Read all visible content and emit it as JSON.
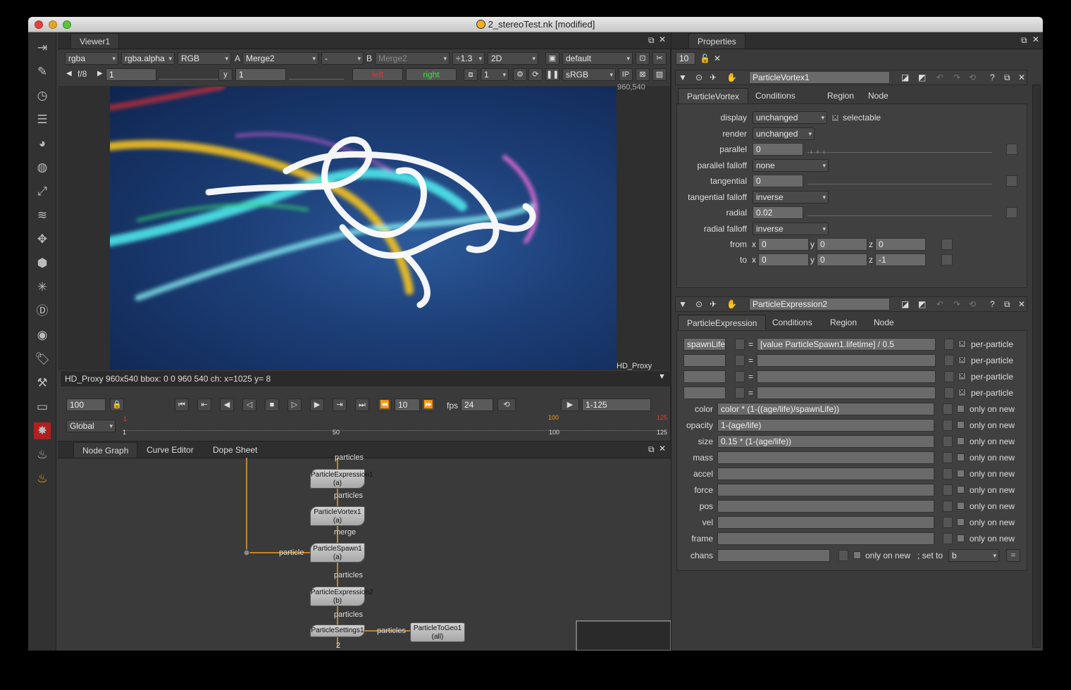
{
  "window": {
    "title": "2_stereoTest.nk [modified]"
  },
  "viewer": {
    "tab": "Viewer1",
    "channels": "rgba",
    "alpha": "rgba.alpha",
    "colorspace": "RGB",
    "a_label": "A",
    "a_input": "Merge2",
    "op": "-",
    "b_label": "B",
    "b_input": "Merge2",
    "zoom": "÷1.3",
    "mode": "2D",
    "lut": "default",
    "fstop": "f/8",
    "gain": "1",
    "gamma_label": "y",
    "gamma": "1",
    "left": "left",
    "right": "right",
    "proxy_num": "1",
    "display": "sRGB",
    "ip": "IP",
    "res_corner": "960,540",
    "format_label": "HD_Proxy",
    "info": "HD_Proxy 960x540 bbox: 0 0 960 540 ch:  x=1025 y=   8",
    "frame": "100",
    "step": "10",
    "fps_label": "fps",
    "fps": "24",
    "range": "1-125",
    "timeline_mode": "Global",
    "ticks": [
      "1",
      "50",
      "100",
      "125"
    ],
    "marks": [
      "1",
      "100",
      "125"
    ]
  },
  "bottom_tabs": [
    "Node Graph",
    "Curve Editor",
    "Dope Sheet"
  ],
  "nodegraph": {
    "nodes": [
      {
        "name": "ParticleExpression1",
        "input": "(a)"
      },
      {
        "name": "ParticleVortex1",
        "input": "(a)"
      },
      {
        "name": "ParticleSpawn1",
        "input": "(a)"
      },
      {
        "name": "ParticleExpression2",
        "input": "(b)"
      },
      {
        "name": "ParticleSettings1",
        "input": ""
      },
      {
        "name": "ParticleToGeo1",
        "input": "(all)"
      }
    ],
    "wires": [
      "particles",
      "particles",
      "merge",
      "particle",
      "particles",
      "particles",
      "particles"
    ],
    "bottom_num": "2"
  },
  "properties": {
    "tab": "Properties",
    "max_panels": "10",
    "vortex": {
      "name": "ParticleVortex1",
      "tabs": [
        "ParticleVortex",
        "Conditions",
        "Region",
        "Node"
      ],
      "display_label": "display",
      "display": "unchanged",
      "selectable": "selectable",
      "render_label": "render",
      "render": "unchanged",
      "parallel_label": "parallel",
      "parallel": "0",
      "parallel_falloff_label": "parallel falloff",
      "parallel_falloff": "none",
      "tangential_label": "tangential",
      "tangential": "0",
      "tangential_falloff_label": "tangential falloff",
      "tangential_falloff": "inverse",
      "radial_label": "radial",
      "radial": "0.02",
      "radial_falloff_label": "radial falloff",
      "radial_falloff": "inverse",
      "from_label": "from",
      "from": {
        "x": "0",
        "y": "0",
        "z": "0"
      },
      "to_label": "to",
      "to": {
        "x": "0",
        "y": "0",
        "z": "-1"
      },
      "axis": [
        "x",
        "y",
        "z"
      ],
      "slider_ticks": [
        "-1",
        "-0.8",
        "-0.6",
        "-0.4",
        "-0.2",
        "0",
        "0.2",
        "0.4",
        "0.6",
        "0.8",
        "1"
      ]
    },
    "expression": {
      "name": "ParticleExpression2",
      "tabs": [
        "ParticleExpression",
        "Conditions",
        "Region",
        "Node"
      ],
      "temps": [
        {
          "name": "spawnLife",
          "expr": "[value ParticleSpawn1.lifetime] / 0.5",
          "flag": "per-particle"
        },
        {
          "name": "",
          "expr": "",
          "flag": "per-particle"
        },
        {
          "name": "",
          "expr": "",
          "flag": "per-particle"
        },
        {
          "name": "",
          "expr": "",
          "flag": "per-particle"
        }
      ],
      "eq": "=",
      "attrs": [
        {
          "label": "color",
          "expr": "color * (1-((age/life)/spawnLife))",
          "flag": "only on new"
        },
        {
          "label": "opacity",
          "expr": "1-(age/life)",
          "flag": "only on new"
        },
        {
          "label": "size",
          "expr": "0.15 * (1-(age/life))",
          "flag": "only on new"
        },
        {
          "label": "mass",
          "expr": "",
          "flag": "only on new"
        },
        {
          "label": "accel",
          "expr": "",
          "flag": "only on new"
        },
        {
          "label": "force",
          "expr": "",
          "flag": "only on new"
        },
        {
          "label": "pos",
          "expr": "",
          "flag": "only on new"
        },
        {
          "label": "vel",
          "expr": "",
          "flag": "only on new"
        },
        {
          "label": "frame",
          "expr": "",
          "flag": "only on new"
        }
      ],
      "chans_label": "chans",
      "chans_flag": "only on new",
      "set_to_label": "; set to",
      "set_to": "b",
      "equals_btn": "="
    }
  }
}
